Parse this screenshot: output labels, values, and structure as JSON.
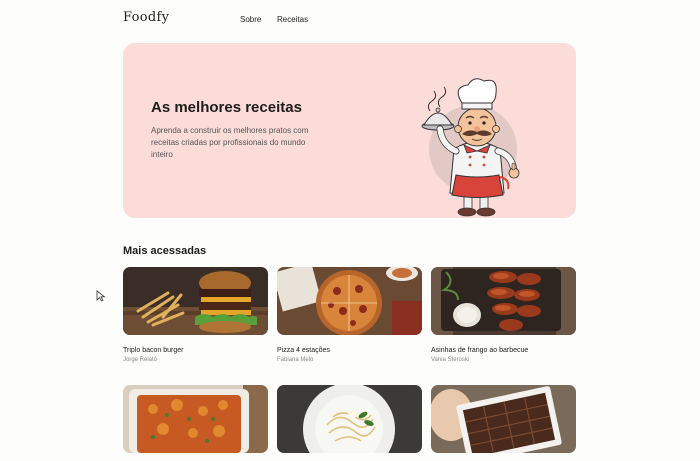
{
  "header": {
    "logo": "Foodfy",
    "nav": [
      {
        "label": "Sobre"
      },
      {
        "label": "Receitas"
      }
    ]
  },
  "hero": {
    "title": "As melhores receitas",
    "description": "Aprenda a construir os melhores pratos com receitas criadas por profissionais do mundo inteiro",
    "background": "#fbdcd8"
  },
  "section": {
    "title": "Mais acessadas"
  },
  "recipes": [
    {
      "name": "Triplo bacon burger",
      "author": "Jorge Relató"
    },
    {
      "name": "Pizza 4 estações",
      "author": "Fabiana Melo"
    },
    {
      "name": "Asinhas de frango ao barbecue",
      "author": "Vania Steroski"
    },
    {
      "name": "",
      "author": ""
    },
    {
      "name": "",
      "author": ""
    },
    {
      "name": "",
      "author": ""
    }
  ]
}
